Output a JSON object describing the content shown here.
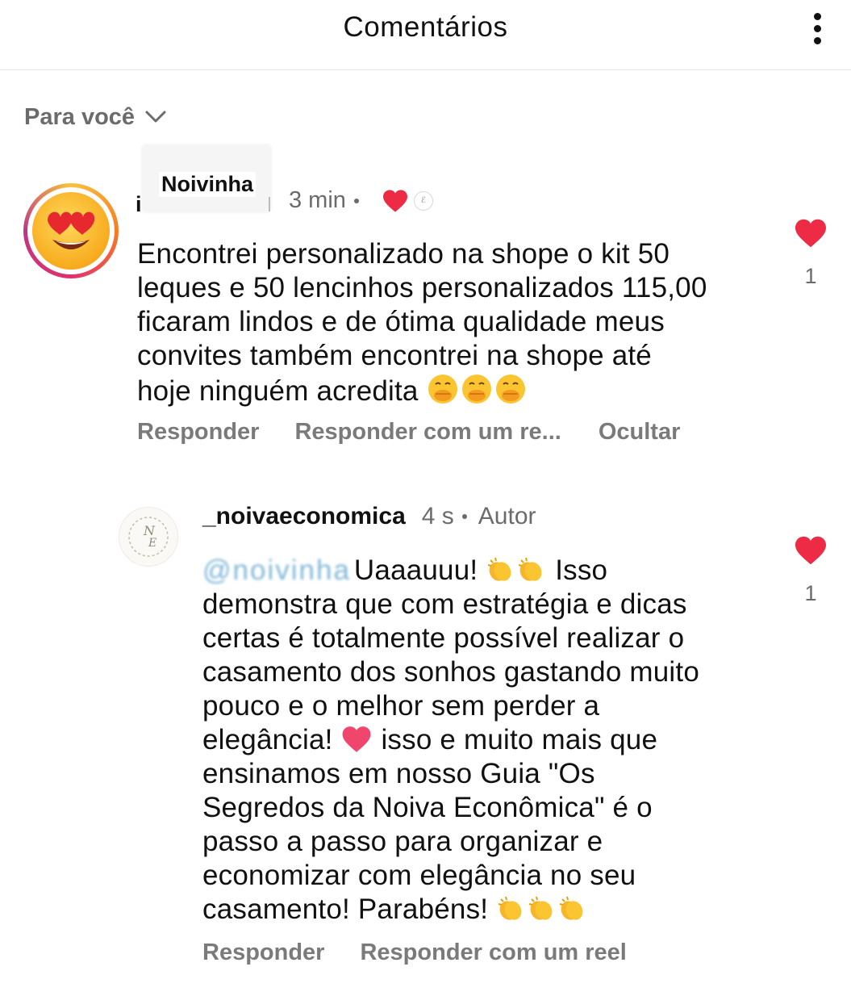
{
  "header": {
    "title": "Comentários",
    "more_icon": "more-vertical-icon"
  },
  "filter": {
    "label": "Para você",
    "icon": "chevron-down-icon"
  },
  "comments": [
    {
      "username": "Noivinha",
      "username_prefix": "i",
      "time": "3 min",
      "author_liked": true,
      "lines": [
        "Encontrei personalizado na shope o kit 50",
        "leques e 50 lencinhos personalizados 115,00",
        "ficaram lindos e de ótima qualidade meus",
        "convites também encontrei na shope até",
        "hoje ninguém acredita"
      ],
      "trailing_emoji": "face-with-hand-over-mouth x3",
      "actions": [
        "Responder",
        "Responder com um re...",
        "Ocultar"
      ],
      "likes": "1"
    },
    {
      "username": "_noivaeconomica",
      "time": "4 s",
      "badge": "Autor",
      "mention_blurred": "@noivinha",
      "lines": [
        "Uaaauuu!",
        "Isso",
        "demonstra que com estratégia e dicas",
        "certas é totalmente possível realizar o",
        "casamento dos sonhos gastando muito",
        "pouco e o melhor sem perder a",
        "elegância!",
        "isso e muito mais que",
        "ensinamos em nosso Guia \"Os",
        "Segredos da Noiva Econômica\" é o",
        "passo a passo para organizar e",
        "economizar com elegância no seu",
        "casamento! Parabéns!"
      ],
      "actions": [
        "Responder",
        "Responder com um reel"
      ],
      "likes": "1"
    }
  ],
  "colors": {
    "like_red": "#ed2b45",
    "muted_text": "#6b6b6b",
    "action_text": "#7a7a7a"
  }
}
